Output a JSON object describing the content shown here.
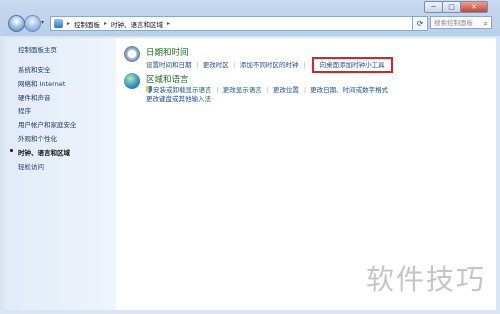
{
  "window": {
    "controls": [
      "─",
      "□",
      "✕"
    ]
  },
  "nav": {
    "breadcrumb": [
      "控制面板",
      "时钟、语言和区域"
    ],
    "search_placeholder": "搜索控制面板"
  },
  "sidebar": {
    "home": "控制面板主页",
    "items": [
      {
        "label": "系统和安全"
      },
      {
        "label": "网络和 Internet"
      },
      {
        "label": "硬件和声音"
      },
      {
        "label": "程序"
      },
      {
        "label": "用户帐户和家庭安全"
      },
      {
        "label": "外观和个性化"
      },
      {
        "label": "时钟、语言和区域",
        "active": true
      },
      {
        "label": "轻松访问"
      }
    ]
  },
  "categories": {
    "datetime": {
      "title": "日期和时间",
      "links": [
        "设置时间和日期",
        "更改时区",
        "添加不同时区的时钟",
        "向桌面添加时钟小工具"
      ]
    },
    "region": {
      "title": "区域和语言",
      "links": [
        "安装或卸载显示语言",
        "更改显示语言",
        "更改位置",
        "更改日期、时间或数字格式"
      ],
      "links2": [
        "更改键盘或其他输入法"
      ]
    }
  },
  "watermark": "软件技巧",
  "colors": {
    "highlight": "#d62525",
    "link": "#1a4f9c",
    "category_title": "#1d6b27"
  }
}
